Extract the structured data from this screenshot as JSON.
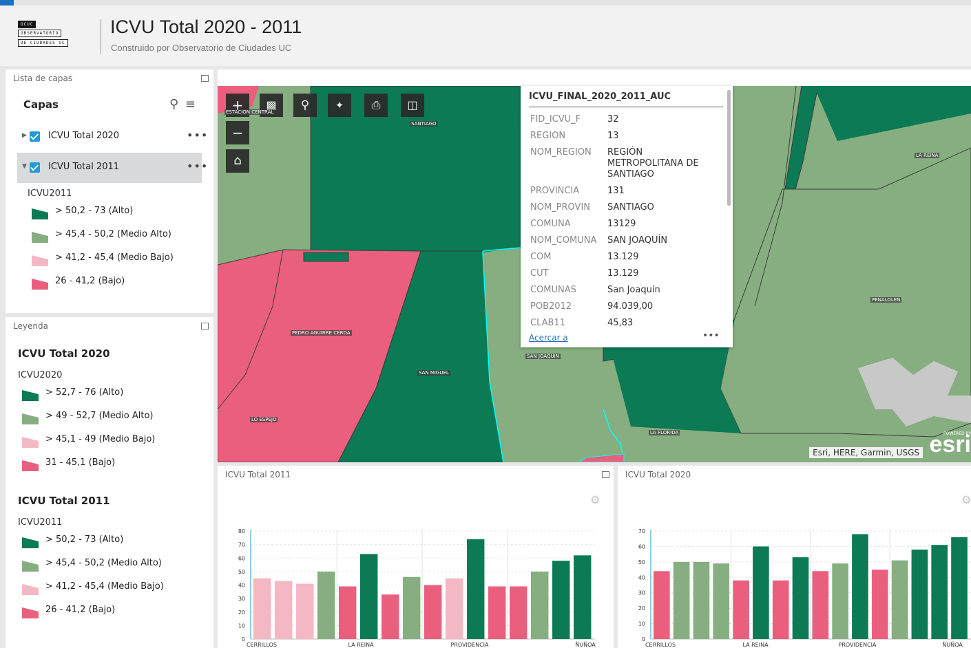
{
  "header": {
    "logo_lines": [
      "ocuc",
      "observatorio",
      "de ciudades uc"
    ],
    "title": "ICVU Total 2020 - 2011",
    "subtitle": "Construido por Observatorio de Ciudades UC"
  },
  "layer_list": {
    "panel_title": "Lista de capas",
    "heading": "Capas",
    "layers": [
      {
        "label": "ICVU Total 2020",
        "checked": true,
        "expanded": false
      },
      {
        "label": "ICVU Total 2011",
        "checked": true,
        "expanded": true
      }
    ],
    "sublegend": {
      "field": "ICVU2011",
      "items": [
        {
          "label": "> 50,2 - 73 (Alto)",
          "color": "#0b7a55"
        },
        {
          "label": "> 45,4 - 50,2 (Medio Alto)",
          "color": "#86ae80"
        },
        {
          "label": "> 41,2 - 45,4 (Medio Bajo)",
          "color": "#f3b8c3"
        },
        {
          "label": "26 - 41,2 (Bajo)",
          "color": "#ea5f7e"
        }
      ]
    }
  },
  "legend": {
    "panel_title": "Leyenda",
    "groups": [
      {
        "title": "ICVU Total 2020",
        "field": "ICVU2020",
        "items": [
          {
            "label": "> 52,7 - 76 (Alto)",
            "color": "#0b7a55"
          },
          {
            "label": "> 49 - 52,7 (Medio Alto)",
            "color": "#86ae80"
          },
          {
            "label": "> 45,1 - 49 (Medio Bajo)",
            "color": "#f3b8c3"
          },
          {
            "label": "31 - 45,1 (Bajo)",
            "color": "#ea5f7e"
          }
        ]
      },
      {
        "title": "ICVU Total 2011",
        "field": "ICVU2011",
        "items": [
          {
            "label": "> 50,2 - 73 (Alto)",
            "color": "#0b7a55"
          },
          {
            "label": "> 45,4 - 50,2 (Medio Alto)",
            "color": "#86ae80"
          },
          {
            "label": "> 41,2 - 45,4 (Medio Bajo)",
            "color": "#f3b8c3"
          },
          {
            "label": "26 - 41,2 (Bajo)",
            "color": "#ea5f7e"
          }
        ]
      }
    ]
  },
  "map": {
    "tools": [
      "plus-icon",
      "layers-icon",
      "search-icon",
      "select-icon",
      "print-icon",
      "compare-icon"
    ],
    "nav": [
      "minus-icon",
      "home-icon"
    ],
    "labels": [
      "ESTACION CENTRAL",
      "SANTIAGO",
      "LA REINA",
      "PEDRO AGUIRRE CERDA",
      "SAN MIGUEL",
      "SAN JOAQUIN",
      "LO ESPEJO",
      "PEÑALOLEN",
      "LA FLORIDA"
    ],
    "attribution": "Esri, HERE, Garmin, USGS",
    "esri_powered": "POWERED BY",
    "esri_logo": "esri"
  },
  "popup": {
    "title": "ICVU_FINAL_2020_2011_AUC",
    "fields": [
      {
        "key": "FID_ICVU_F",
        "value": "32"
      },
      {
        "key": "REGION",
        "value": "13"
      },
      {
        "key": "NOM_REGION",
        "value": "REGIÓN METROPOLITANA DE SANTIAGO"
      },
      {
        "key": "PROVINCIA",
        "value": "131"
      },
      {
        "key": "NOM_PROVIN",
        "value": "SANTIAGO"
      },
      {
        "key": "COMUNA",
        "value": "13129"
      },
      {
        "key": "NOM_COMUNA",
        "value": "SAN JOAQUÍN"
      },
      {
        "key": "COM",
        "value": "13.129"
      },
      {
        "key": "CUT",
        "value": "13.129"
      },
      {
        "key": "COMUNAS",
        "value": "San Joaquín"
      },
      {
        "key": "POB2012",
        "value": "94.039,00"
      },
      {
        "key": "CLAB11",
        "value": "45,83"
      }
    ],
    "zoom_link": "Acercar a",
    "more": "•••"
  },
  "chart_data": [
    {
      "type": "bar",
      "title": "ICVU Total 2011",
      "ylim": [
        0,
        80
      ],
      "yticks": [
        0,
        10,
        20,
        30,
        40,
        50,
        60,
        70,
        80
      ],
      "xticks": [
        "CERRILLOS",
        "LA REINA",
        "PROVIDENCIA",
        "ÑUÑOA"
      ],
      "values": [
        45,
        43,
        41,
        50,
        39,
        63,
        33,
        46,
        40,
        45,
        74,
        39,
        39,
        50,
        58,
        62
      ],
      "colors": [
        "#f3b8c3",
        "#f3b8c3",
        "#f3b8c3",
        "#86ae80",
        "#ea5f7e",
        "#0b7a55",
        "#ea5f7e",
        "#86ae80",
        "#ea5f7e",
        "#f3b8c3",
        "#0b7a55",
        "#ea5f7e",
        "#ea5f7e",
        "#86ae80",
        "#0b7a55",
        "#0b7a55"
      ]
    },
    {
      "type": "bar",
      "title": "ICVU Total 2020",
      "ylim": [
        0,
        70
      ],
      "yticks": [
        0,
        10,
        20,
        30,
        40,
        50,
        60,
        70
      ],
      "xticks": [
        "CERRILLOS",
        "LA REINA",
        "PROVIDENCIA",
        "ÑUÑOA"
      ],
      "values": [
        44,
        50,
        50,
        49,
        38,
        60,
        38,
        53,
        44,
        49,
        68,
        45,
        51,
        58,
        61,
        66
      ],
      "colors": [
        "#ea5f7e",
        "#86ae80",
        "#86ae80",
        "#86ae80",
        "#ea5f7e",
        "#0b7a55",
        "#ea5f7e",
        "#0b7a55",
        "#ea5f7e",
        "#86ae80",
        "#0b7a55",
        "#ea5f7e",
        "#86ae80",
        "#0b7a55",
        "#0b7a55",
        "#0b7a55"
      ]
    }
  ]
}
